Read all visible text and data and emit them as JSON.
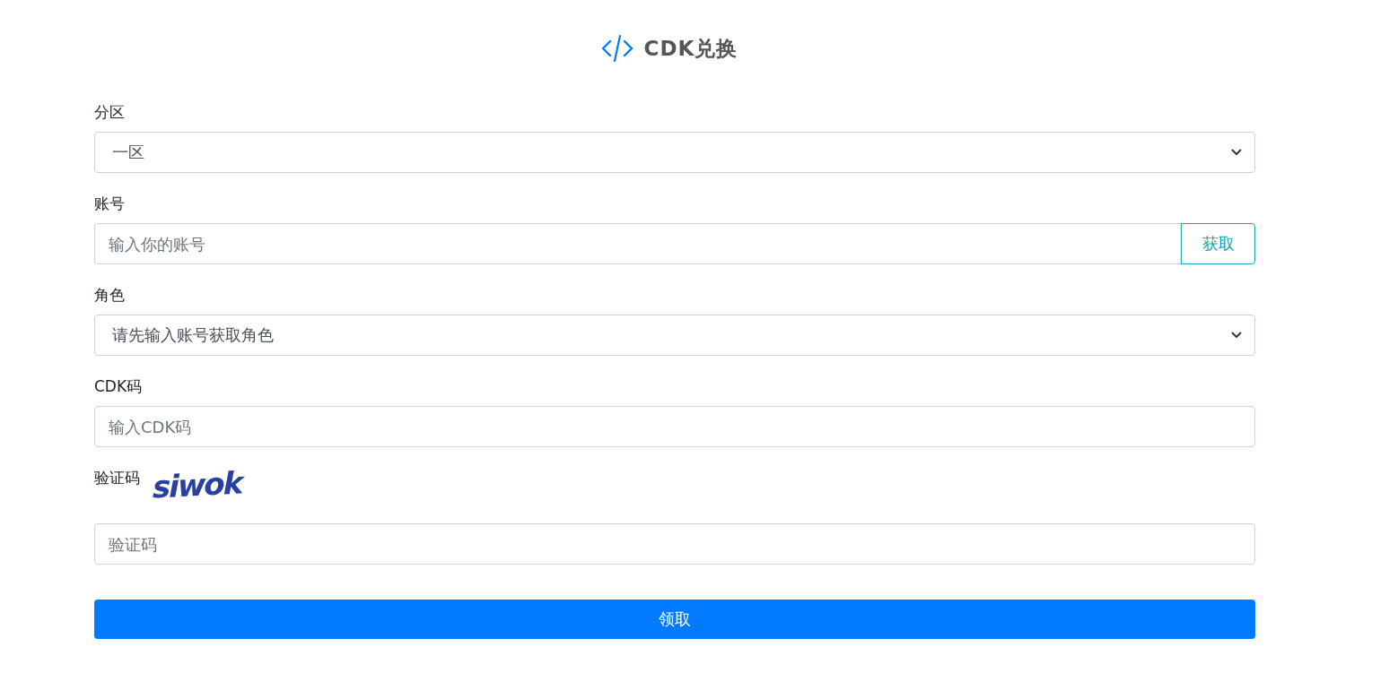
{
  "header": {
    "title": "CDK兑换"
  },
  "form": {
    "fields": [
      {
        "kind": "select",
        "label": "分区",
        "value": "一区"
      },
      {
        "kind": "input_button",
        "label": "账号",
        "placeholder": "输入你的账号",
        "button": "获取"
      },
      {
        "kind": "select",
        "label": "角色",
        "value": "请先输入账号获取角色"
      },
      {
        "kind": "input",
        "label": "CDK码",
        "placeholder": "输入CDK码"
      },
      {
        "kind": "captcha",
        "label": "验证码",
        "captcha": "siwok",
        "placeholder": "验证码"
      }
    ],
    "submit": "领取"
  }
}
